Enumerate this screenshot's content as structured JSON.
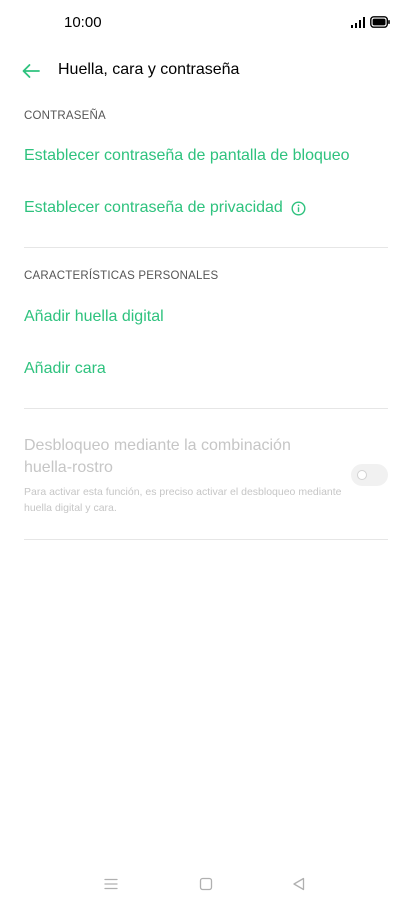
{
  "status": {
    "time": "10:00"
  },
  "header": {
    "title": "Huella, cara y contraseña"
  },
  "sections": {
    "password": {
      "header": "CONTRASEÑA",
      "lock_screen": "Establecer contraseña de pantalla de bloqueo",
      "privacy": "Establecer contraseña de privacidad"
    },
    "personal": {
      "header": "CARACTERÍSTICAS PERSONALES",
      "fingerprint": "Añadir huella digital",
      "face": "Añadir cara"
    },
    "combo": {
      "title": "Desbloqueo mediante la combinación huella-rostro",
      "description": "Para activar esta función, es preciso activar el desbloqueo mediante huella digital y cara.",
      "enabled": false
    }
  },
  "colors": {
    "accent": "#2ec27e",
    "disabled": "#c6c6c6",
    "divider": "#e6e6e6"
  },
  "icons": [
    "signal-icon",
    "battery-icon",
    "back-arrow-icon",
    "info-icon",
    "menu-icon",
    "home-icon",
    "back-icon"
  ]
}
